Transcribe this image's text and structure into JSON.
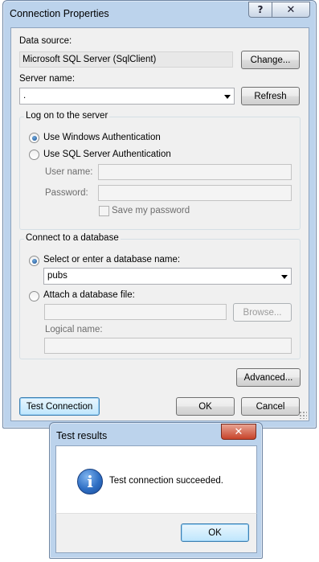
{
  "main_dialog": {
    "title": "Connection Properties",
    "help_glyph": "?",
    "close_glyph": "✕"
  },
  "data_source": {
    "label": "Data source:",
    "value": "Microsoft SQL Server (SqlClient)",
    "change_button": "Change..."
  },
  "server": {
    "label": "Server name:",
    "value": ".",
    "refresh_button": "Refresh"
  },
  "logon": {
    "group_title": "Log on to the server",
    "windows_auth": "Use Windows Authentication",
    "sql_auth": "Use SQL Server Authentication",
    "selected": "windows",
    "user_name_label": "User name:",
    "password_label": "Password:",
    "save_password": "Save my password"
  },
  "database": {
    "group_title": "Connect to a database",
    "select_option": "Select or enter a database name:",
    "database_value": "pubs",
    "attach_option": "Attach a database file:",
    "selected": "select",
    "browse_button": "Browse...",
    "logical_name_label": "Logical name:"
  },
  "buttons": {
    "advanced": "Advanced...",
    "test_connection": "Test Connection",
    "ok": "OK",
    "cancel": "Cancel"
  },
  "test_results": {
    "title": "Test results",
    "close_glyph": "✕",
    "icon_glyph": "i",
    "message": "Test connection succeeded.",
    "ok": "OK"
  }
}
